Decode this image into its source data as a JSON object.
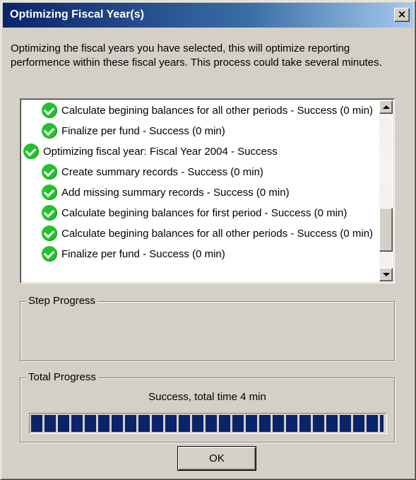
{
  "window": {
    "title": "Optimizing Fiscal Year(s)",
    "close_glyph": "×"
  },
  "description": "Optimizing the fiscal years you have selected, this will optimize reporting performence within these fiscal years.  This process could take several minutes.",
  "log": {
    "items": [
      {
        "level": 2,
        "icon": "check-icon",
        "text": "Calculate begining balances for all other periods - Success (0 min)"
      },
      {
        "level": 2,
        "icon": "check-icon",
        "text": "Finalize per fund - Success (0 min)"
      },
      {
        "level": 1,
        "icon": "check-icon",
        "text": "Optimizing fiscal year: Fiscal Year 2004 - Success"
      },
      {
        "level": 2,
        "icon": "check-icon",
        "text": "Create summary records - Success (0 min)"
      },
      {
        "level": 2,
        "icon": "check-icon",
        "text": "Add missing summary records - Success (0 min)"
      },
      {
        "level": 2,
        "icon": "check-icon",
        "text": "Calculate begining balances for first period - Success (0 min)"
      },
      {
        "level": 2,
        "icon": "check-icon",
        "text": "Calculate begining balances for all other periods - Success (0 min)"
      },
      {
        "level": 2,
        "icon": "check-icon",
        "text": "Finalize per fund - Success (0 min)"
      }
    ],
    "scroll_position_fraction": 0.85,
    "icon_color": "#22c22a"
  },
  "step_progress": {
    "label": "Step Progress"
  },
  "total_progress": {
    "label": "Total Progress",
    "status": "Success, total time 4 min",
    "value_percent": 100,
    "bar_color": "#0a246a"
  },
  "buttons": {
    "ok_label": "OK"
  }
}
